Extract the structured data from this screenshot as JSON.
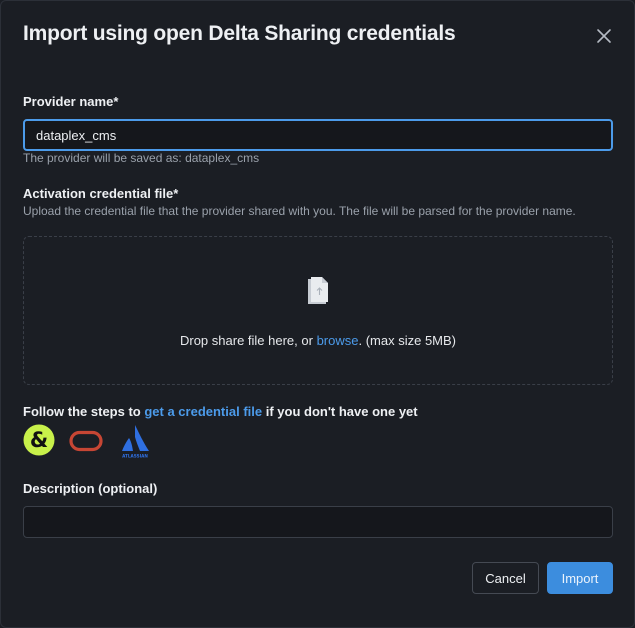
{
  "dialog": {
    "title": "Import using open Delta Sharing credentials",
    "close_icon": "close-icon"
  },
  "provider_name": {
    "label": "Provider name*",
    "value": "dataplex_cms",
    "help": "The provider will be saved as: dataplex_cms"
  },
  "credential_file": {
    "label": "Activation credential file*",
    "help": "Upload the credential file that the provider shared with you. The file will be parsed for the provider name.",
    "drop_prefix": "Drop share file here, or ",
    "browse_link": "browse",
    "drop_suffix": ". (max size 5MB)",
    "icon": "file-upload-icon"
  },
  "steps": {
    "prefix": "Follow the steps to ",
    "link": "get a credential file",
    "suffix": " if you don't have one yet",
    "logos": [
      {
        "name": "ampersand-logo",
        "color": "#c8f14a"
      },
      {
        "name": "oracle-logo",
        "color": "#c74634"
      },
      {
        "name": "atlassian-logo",
        "color": "#2f6fe0",
        "caption": "ATLASSIAN"
      }
    ]
  },
  "description": {
    "label": "Description (optional)",
    "value": "",
    "placeholder": ""
  },
  "footer": {
    "cancel_label": "Cancel",
    "import_label": "Import"
  },
  "colors": {
    "background": "#1b1e24",
    "accent": "#4c9bea",
    "primary_button": "#3c8dde"
  }
}
